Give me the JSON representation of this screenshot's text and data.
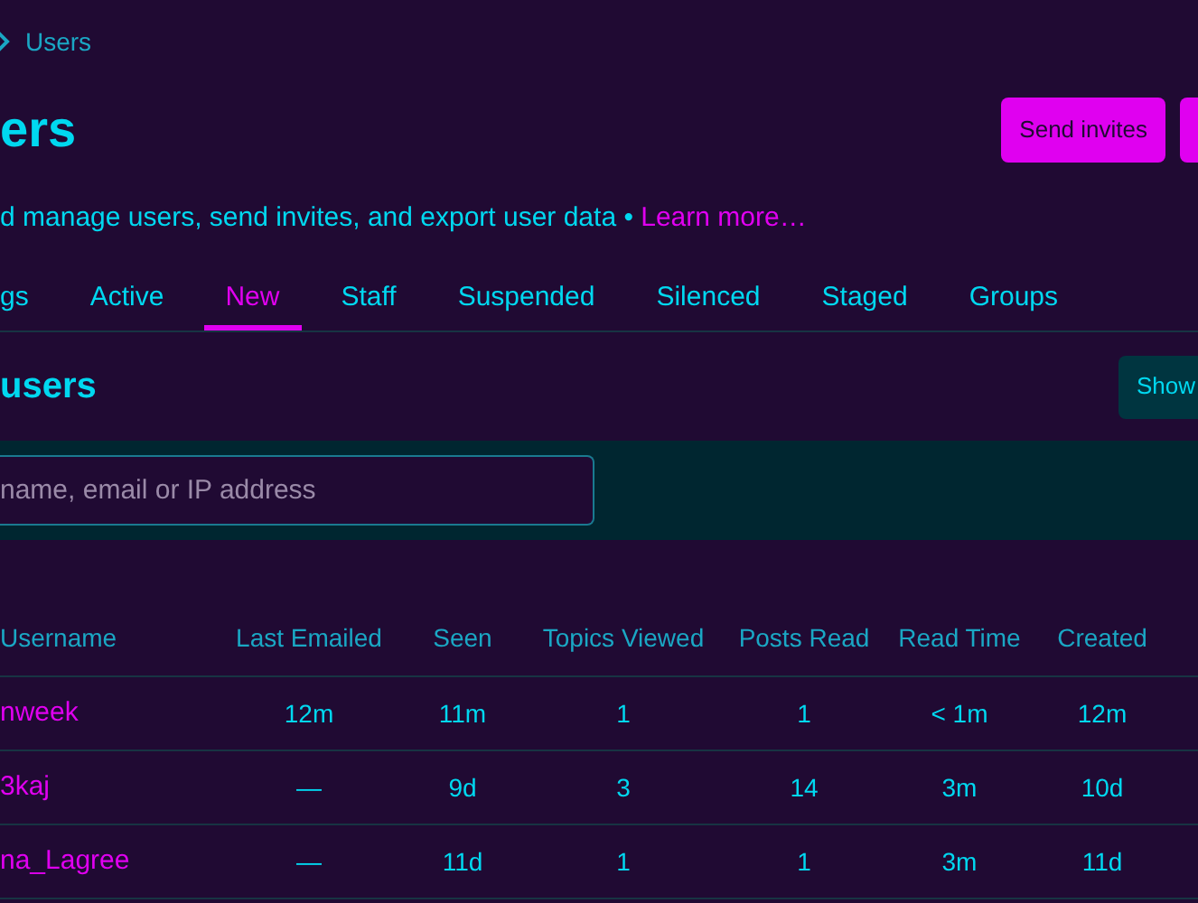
{
  "breadcrumb": {
    "label": "Users"
  },
  "page": {
    "title": "ers",
    "description": "d manage users, send invites, and export user data • ",
    "learn_more": "Learn more…",
    "buttons": [
      "Send invites"
    ]
  },
  "tabs": [
    {
      "label": "gs",
      "selected": false
    },
    {
      "label": "Active",
      "selected": false
    },
    {
      "label": "New",
      "selected": true
    },
    {
      "label": "Staff",
      "selected": false
    },
    {
      "label": "Suspended",
      "selected": false
    },
    {
      "label": "Silenced",
      "selected": false
    },
    {
      "label": "Staged",
      "selected": false
    },
    {
      "label": "Groups",
      "selected": false
    }
  ],
  "section": {
    "title": "users",
    "show_button": "Show"
  },
  "search": {
    "placeholder": "name, email or IP address"
  },
  "table": {
    "columns": [
      "Username",
      "Last Emailed",
      "Seen",
      "Topics Viewed",
      "Posts Read",
      "Read Time",
      "Created"
    ],
    "rows": [
      [
        "nweek",
        "12m",
        "11m",
        "1",
        "1",
        "< 1m",
        "12m"
      ],
      [
        "3kaj",
        "—",
        "9d",
        "3",
        "14",
        "3m",
        "10d"
      ],
      [
        "na_Lagree",
        "—",
        "11d",
        "1",
        "1",
        "3m",
        "11d"
      ]
    ]
  }
}
